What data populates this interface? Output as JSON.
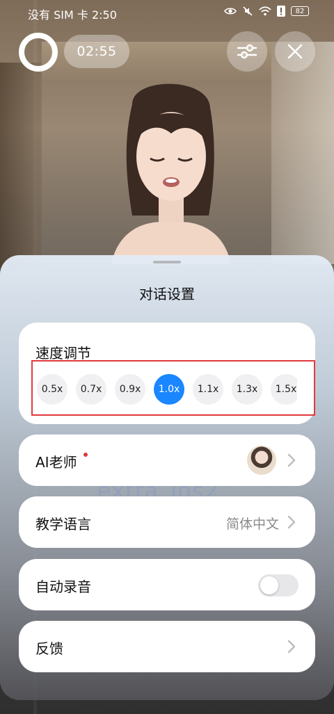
{
  "status_bar": {
    "carrier_time": "没有 SIM 卡 2:50",
    "battery": "82",
    "icons": [
      "eye-icon",
      "mute-icon",
      "wifi-icon",
      "alert-icon",
      "battery-icon"
    ]
  },
  "top_controls": {
    "timer": "02:55",
    "settings_icon": "sliders-icon",
    "close_icon": "close-icon"
  },
  "sheet": {
    "title": "对话设置",
    "watermark": "extra_ios2",
    "speed": {
      "label": "速度调节",
      "options": [
        "0.5x",
        "0.7x",
        "0.9x",
        "1.0x",
        "1.1x",
        "1.3x",
        "1.5x"
      ],
      "selected": "1.0x"
    },
    "ai_teacher": {
      "label": "AI老师",
      "has_badge": true
    },
    "teaching_language": {
      "label": "教学语言",
      "value": "简体中文"
    },
    "auto_record": {
      "label": "自动录音",
      "enabled": false
    },
    "feedback": {
      "label": "反馈"
    }
  },
  "colors": {
    "accent": "#1a86ff",
    "highlight_border": "#e0393c",
    "badge": "#e0393c"
  }
}
